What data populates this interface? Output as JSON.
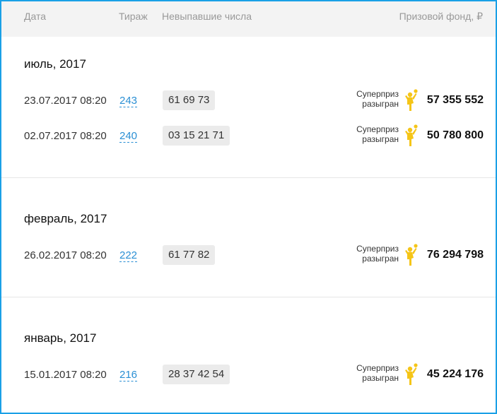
{
  "header": {
    "date": "Дата",
    "draw": "Тираж",
    "numbers": "Невыпавшие числа",
    "prize_fund": "Призовой фонд, ₽"
  },
  "sections": [
    {
      "month": "июль, 2017",
      "rows": [
        {
          "date": "23.07.2017 08:20",
          "draw": "243",
          "numbers": "61 69 73",
          "super_line1": "Суперприз",
          "super_line2": "разыгран",
          "prize": "57 355 552"
        },
        {
          "date": "02.07.2017 08:20",
          "draw": "240",
          "numbers": "03 15 21 71",
          "super_line1": "Суперприз",
          "super_line2": "разыгран",
          "prize": "50 780 800"
        }
      ]
    },
    {
      "month": "февраль, 2017",
      "rows": [
        {
          "date": "26.02.2017 08:20",
          "draw": "222",
          "numbers": "61 77 82",
          "super_line1": "Суперприз",
          "super_line2": "разыгран",
          "prize": "76 294 798"
        }
      ]
    },
    {
      "month": "январь, 2017",
      "rows": [
        {
          "date": "15.01.2017 08:20",
          "draw": "216",
          "numbers": "28 37 42 54",
          "super_line1": "Суперприз",
          "super_line2": "разыгран",
          "prize": "45 224 176"
        }
      ]
    }
  ],
  "colors": {
    "accent": "#1aa0e6",
    "link": "#2a8fd4",
    "winner_icon": "#f5c518"
  },
  "icons": {
    "winner": "jumping-person-icon"
  }
}
